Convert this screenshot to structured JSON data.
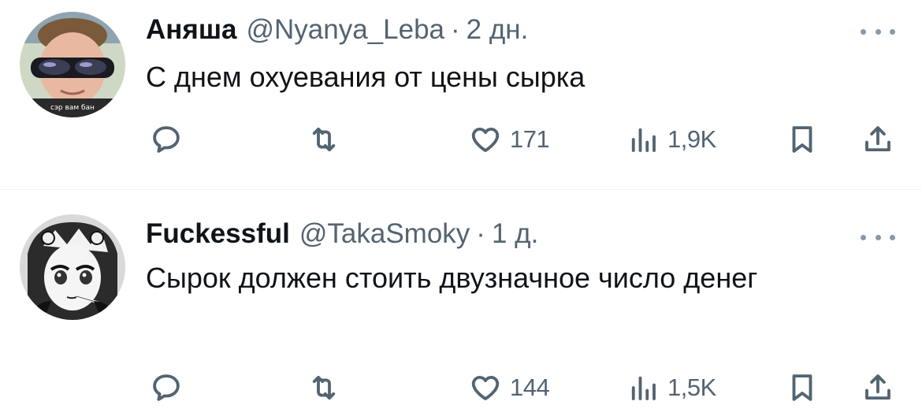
{
  "tweets": [
    {
      "name": "Аняша",
      "handle": "@Nyanya_Leba",
      "separator": "·",
      "time": "2 дн.",
      "text": "С днем охуевания от цены сырка",
      "likes": "171",
      "views": "1,9K",
      "avatar_caption": "сэр вам бан"
    },
    {
      "name": "Fuckessful",
      "handle": "@TakaSmoky",
      "separator": "·",
      "time": "1 д.",
      "text": "Сырок должен стоить двузначное число денег",
      "likes": "144",
      "views": "1,5K"
    }
  ],
  "colors": {
    "text_primary": "#0f1419",
    "text_secondary": "#536471",
    "divider": "#eff3f4"
  },
  "icons": [
    "reply-icon",
    "retweet-icon",
    "like-icon",
    "views-icon",
    "bookmark-icon",
    "share-icon",
    "more-icon"
  ]
}
